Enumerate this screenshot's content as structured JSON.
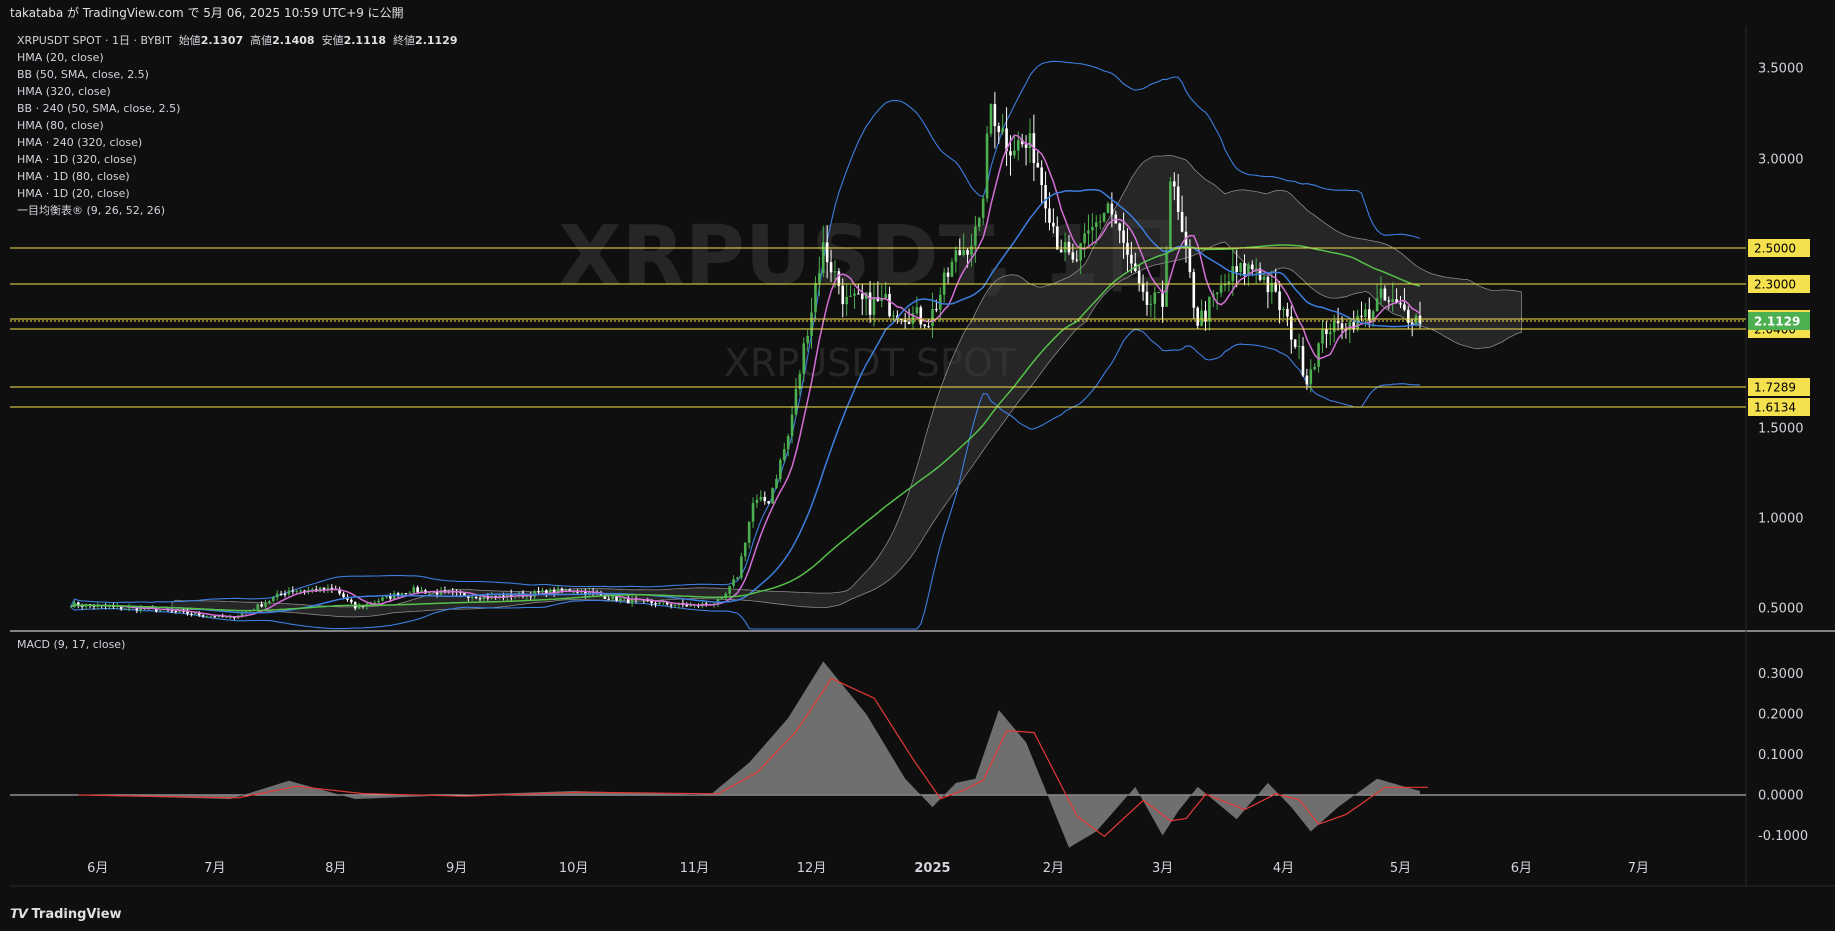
{
  "header": {
    "publish_text": "takataba が TradingView.com で 5月 06, 2025 10:59 UTC+9 に公開"
  },
  "legend": {
    "symbol_line": "XRPUSDT SPOT · 1日 · BYBIT",
    "open_label": "始値",
    "open_value": "2.1307",
    "high_label": "高値",
    "high_value": "2.1408",
    "low_label": "安値",
    "low_value": "2.1118",
    "close_label": "終値",
    "close_value": "2.1129",
    "indicators": [
      "HMA (20, close)",
      "BB (50, SMA, close, 2.5)",
      "HMA (320, close)",
      "BB · 240 (50, SMA, close, 2.5)",
      "HMA (80, close)",
      "HMA · 240 (320, close)",
      "HMA · 1D (320, close)",
      "HMA · 1D (80, close)",
      "HMA · 1D (20, close)",
      "一目均衡表® (9, 26, 52, 26)"
    ]
  },
  "watermark": {
    "big": "XRPUSDT, 1日",
    "small": "XRPUSDT SPOT"
  },
  "macd_legend": "MACD (9, 17, close)",
  "footer": {
    "brand": "TradingView"
  },
  "colors": {
    "background": "#0f0f0f",
    "bull": "#4caf50",
    "bear": "#ffffff",
    "hline": "#f5e04d",
    "price_tag": "#4caf50",
    "bb": "#3d7ee0",
    "hma_fast": "#d36fd6",
    "hma_slow": "#56c04a",
    "macd_fill": "#808080",
    "signal": "#e53935"
  },
  "chart_data": [
    {
      "type": "line",
      "title": "XRPUSDT SPOT · 1日 · BYBIT",
      "x_tick_labels": [
        "6月",
        "7月",
        "8月",
        "9月",
        "10月",
        "11月",
        "12月",
        "2025",
        "2月",
        "3月",
        "4月",
        "5月",
        "6月",
        "7月"
      ],
      "y_tick_labels": [
        "3.5000",
        "3.0000",
        "1.5000",
        "1.0000",
        "0.5000"
      ],
      "horizontal_levels": [
        "2.5000",
        "2.3000",
        "2.1200",
        "2.0400",
        "1.7289",
        "1.6134"
      ],
      "last_price": "2.1129",
      "series": [
        {
          "name": "close",
          "x": [
            "2024-05-25",
            "2024-06-15",
            "2024-07-05",
            "2024-07-20",
            "2024-08-01",
            "2024-08-06",
            "2024-08-20",
            "2024-09-10",
            "2024-10-01",
            "2024-10-15",
            "2024-11-01",
            "2024-11-08",
            "2024-11-12",
            "2024-11-16",
            "2024-11-20",
            "2024-11-25",
            "2024-12-02",
            "2024-12-04",
            "2024-12-10",
            "2024-12-20",
            "2024-12-31",
            "2025-01-07",
            "2025-01-13",
            "2025-01-16",
            "2025-01-20",
            "2025-01-27",
            "2025-02-02",
            "2025-02-06",
            "2025-02-15",
            "2025-02-24",
            "2025-03-01",
            "2025-03-03",
            "2025-03-10",
            "2025-03-19",
            "2025-03-25",
            "2025-04-01",
            "2025-04-07",
            "2025-04-12",
            "2025-04-20",
            "2025-04-26",
            "2025-05-06"
          ],
          "y": [
            0.52,
            0.49,
            0.43,
            0.6,
            0.6,
            0.5,
            0.6,
            0.56,
            0.6,
            0.54,
            0.51,
            0.54,
            0.68,
            1.08,
            1.1,
            1.45,
            2.3,
            2.5,
            2.2,
            2.2,
            2.1,
            2.45,
            2.6,
            3.3,
            3.1,
            3.05,
            2.55,
            2.4,
            2.75,
            2.2,
            2.2,
            2.9,
            2.1,
            2.35,
            2.4,
            2.15,
            1.78,
            2.05,
            2.1,
            2.22,
            2.1129
          ]
        }
      ]
    },
    {
      "type": "area",
      "title": "MACD (9, 17, close)",
      "y_tick_labels": [
        "0.3000",
        "0.2000",
        "0.1000",
        "0.0000",
        "-0.1000"
      ],
      "series": [
        {
          "name": "MACD",
          "x": [
            "2024-05-25",
            "2024-07-05",
            "2024-07-20",
            "2024-08-06",
            "2024-09-01",
            "2024-10-01",
            "2024-11-05",
            "2024-11-15",
            "2024-11-25",
            "2024-12-04",
            "2024-12-15",
            "2024-12-25",
            "2025-01-01",
            "2025-01-07",
            "2025-01-12",
            "2025-01-18",
            "2025-01-25",
            "2025-02-05",
            "2025-02-12",
            "2025-02-22",
            "2025-03-01",
            "2025-03-05",
            "2025-03-10",
            "2025-03-20",
            "2025-03-28",
            "2025-04-03",
            "2025-04-08",
            "2025-04-15",
            "2025-04-25",
            "2025-05-06"
          ],
          "y": [
            0,
            -0.01,
            0.035,
            -0.01,
            0,
            0.01,
            0,
            0.08,
            0.19,
            0.33,
            0.2,
            0.04,
            -0.03,
            0.03,
            0.04,
            0.21,
            0.13,
            -0.13,
            -0.09,
            0.02,
            -0.1,
            -0.04,
            0.02,
            -0.06,
            0.03,
            -0.03,
            -0.09,
            -0.03,
            0.04,
            0.01
          ]
        }
      ]
    }
  ]
}
